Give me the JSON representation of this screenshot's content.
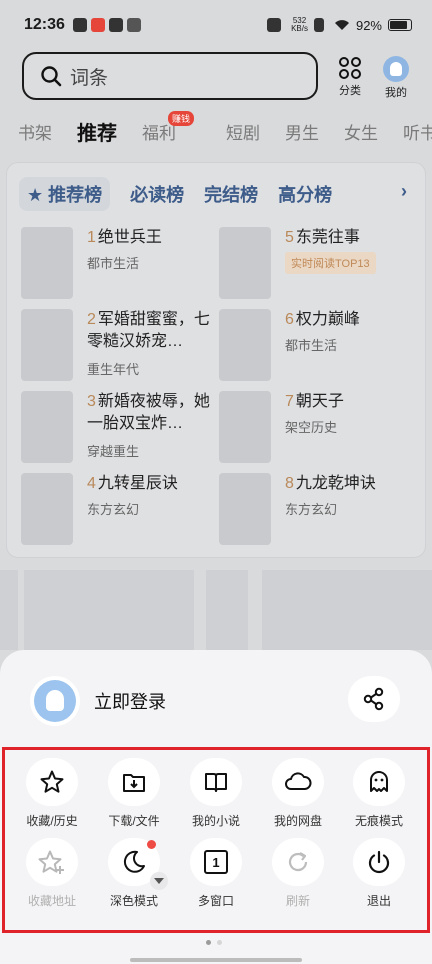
{
  "status": {
    "time": "12:36",
    "speed_top": "532",
    "speed_bottom": "KB/s",
    "battery": "92%"
  },
  "search": {
    "placeholder": "词条"
  },
  "top_icons": {
    "category": "分类",
    "mine": "我的"
  },
  "tabs": [
    {
      "label": "书架"
    },
    {
      "label": "推荐"
    },
    {
      "label": "福利",
      "badge": "赚钱"
    },
    {
      "label": "短剧"
    },
    {
      "label": "男生"
    },
    {
      "label": "女生"
    },
    {
      "label": "听书"
    }
  ],
  "rank_tabs": [
    "★ 推荐榜",
    "必读榜",
    "完结榜",
    "高分榜"
  ],
  "books": [
    {
      "rank": "1",
      "title": "绝世兵王",
      "sub": "都市生活"
    },
    {
      "rank": "2",
      "title": "军婚甜蜜蜜，七零糙汉娇宠…",
      "sub": "重生年代"
    },
    {
      "rank": "3",
      "title": "新婚夜被辱，她一胎双宝炸…",
      "sub": "穿越重生"
    },
    {
      "rank": "4",
      "title": "九转星辰诀",
      "sub": "东方玄幻"
    },
    {
      "rank": "5",
      "title": "东莞往事",
      "tag": "实时阅读TOP13"
    },
    {
      "rank": "6",
      "title": "权力巅峰",
      "sub": "都市生活"
    },
    {
      "rank": "7",
      "title": "朝天子",
      "sub": "架空历史"
    },
    {
      "rank": "8",
      "title": "九龙乾坤诀",
      "sub": "东方玄幻"
    }
  ],
  "sheet": {
    "login_label": "立即登录",
    "tools": [
      {
        "label": "收藏/历史",
        "icon": "star-icon"
      },
      {
        "label": "下载/文件",
        "icon": "download-icon"
      },
      {
        "label": "我的小说",
        "icon": "book-icon"
      },
      {
        "label": "我的网盘",
        "icon": "cloud-icon"
      },
      {
        "label": "无痕模式",
        "icon": "ghost-icon"
      },
      {
        "label": "收藏地址",
        "icon": "star-plus-icon",
        "disabled": true
      },
      {
        "label": "深色模式",
        "icon": "moon-icon"
      },
      {
        "label": "多窗口",
        "icon": "window-icon",
        "value": "1"
      },
      {
        "label": "刷新",
        "icon": "refresh-icon",
        "disabled": true
      },
      {
        "label": "退出",
        "icon": "power-icon"
      }
    ]
  }
}
